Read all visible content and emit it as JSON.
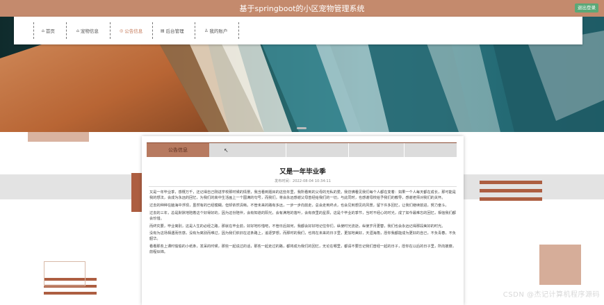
{
  "header": {
    "title": "基于springboot的小区宠物管理系统",
    "exit_label": "退出登录"
  },
  "nav": {
    "items": [
      {
        "icon": "home-icon",
        "glyph": "⌂",
        "label": "首页",
        "active": false
      },
      {
        "icon": "pet-icon",
        "glyph": "⌂",
        "label": "宠物信息",
        "active": false
      },
      {
        "icon": "notice-icon",
        "glyph": "◎",
        "label": "公告信息",
        "active": true
      },
      {
        "icon": "admin-icon",
        "glyph": "▤",
        "label": "后台管理",
        "active": false
      },
      {
        "icon": "user-icon",
        "glyph": "♙",
        "label": "我的账户",
        "active": false
      }
    ]
  },
  "notice": {
    "tab_label": "公告信息",
    "title": "又是一年毕业季",
    "publish_time": "发布时间：2022-08-04 10:34:11",
    "paragraphs": [
      "又是一年毕业季，感慨万千，还记得自己刚进学校那时候的情景，我当看到题目的这些年里，我所看到的父母的无私的爱。我仿佛看见我们每个人都在变着：如果一个人每天都在成长，那可能是我的想法，会成为永远的回忆，为我们的高中生活画上一个圆满的句号，而我们，将会永远感谢父母曾经给我们的一切，与此同时，也感谢母校给予我们的教导，感谢老师对我们的关怀。",
      "过去的种种在脑海中浮现，虽然有的已经模糊，但却依然清晰。不管未来的路有多远，一步一步向前走，总会走到终点，也会见到想见的风景，留下许多回忆，让我们继续前进，努力奋斗。",
      "过去的三年，总是默默地陪着这个好得好的，因为这份陪伴，会有知道的阳光，会有满地的落叶，会有夜里的星辰，这是个毕业的季节，当时不经心的时光，成了如今最难忘的回忆，相信我们都会珍惜。",
      "而终究要，毕业离别，这是人生的必经之路，那就在毕业前，好好地珍惜吧，不管日后如何，我都会好好地记住你们，纵使时光流逝，纵使岁月更替，我们也会永远记得那段美好的时光。",
      "没有为这场相遇而伤感，没有为离别而难过，因为我们依旧在这条路上，追逐梦想，而那时的我们，也将在未来的日子里，更加地美好，天涯海角，愿你我都能成为更好的自己，不负青春，不负韶华。",
      "看看那些上课时偷偷的小纸条，发呆的时候，那些一起说过的话，那些一起走过的路，都将成为我们的回忆，无论在哪里，都请不要忘记我们曾经一起的日子，愿你在以后的日子里，所向披靡，前程似锦。"
    ]
  },
  "watermark": "CSDN @杰记计算机程序源码",
  "colors": {
    "brand": "#c48a6d",
    "active_nav": "#c57a5a",
    "exit_button": "#5aa877"
  }
}
